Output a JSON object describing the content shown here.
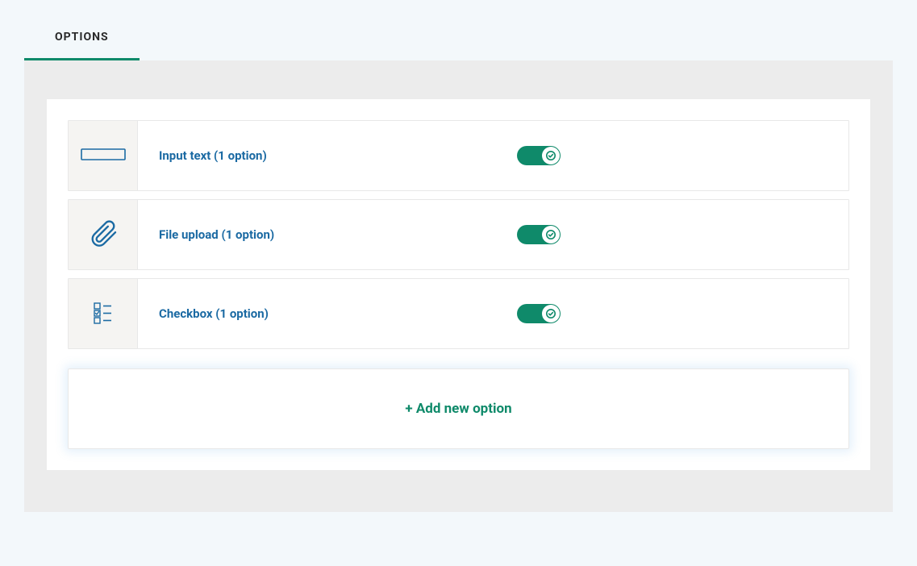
{
  "tabs": {
    "options": "OPTIONS"
  },
  "options": [
    {
      "label": "Input text (1 option)",
      "enabled": true,
      "icon": "input-text-icon"
    },
    {
      "label": "File upload (1 option)",
      "enabled": true,
      "icon": "paperclip-icon"
    },
    {
      "label": "Checkbox (1 option)",
      "enabled": true,
      "icon": "checklist-icon"
    }
  ],
  "add_button": "+ Add new option",
  "colors": {
    "accent": "#0f8a6a",
    "link": "#1b6aa3"
  }
}
